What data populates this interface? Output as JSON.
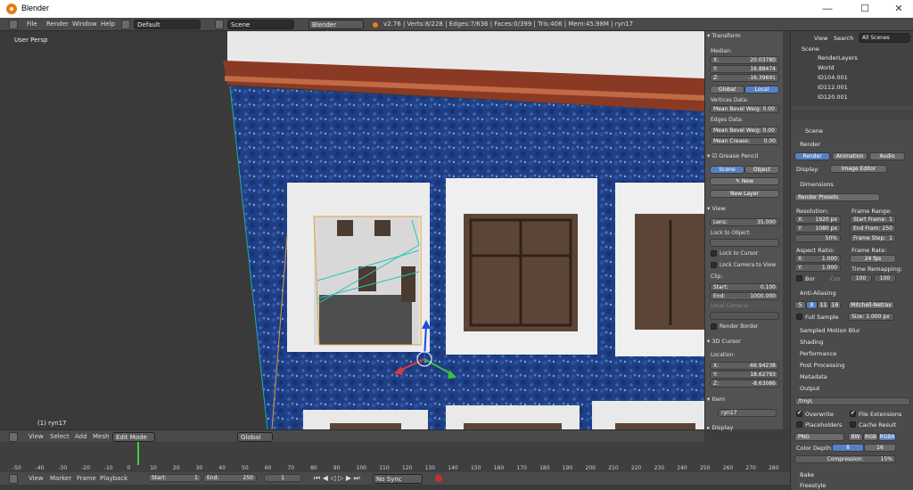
{
  "window": {
    "title": "Blender",
    "min": "—",
    "max": "☐",
    "close": "✕"
  },
  "topbar": {
    "menus": [
      "File",
      "Render",
      "Window",
      "Help"
    ],
    "layout": "Default",
    "scene": "Scene",
    "engine": "Blender Render",
    "stats": "v2.76 | Verts:8/228 | Edges:7/636 | Faces:0/399 | Tris:406 | Mem:45.98M | ryn17"
  },
  "viewport": {
    "view_label": "User Persp",
    "object_label": "(1) ryn17"
  },
  "npanel": {
    "transform": "Transform",
    "median": "Median:",
    "x": "X:",
    "x_val": "20.03780",
    "y": "Y:",
    "y_val": "16.88474",
    "z": "Z:",
    "z_val": "-16.39691",
    "global": "Global",
    "local": "Local",
    "vertices_data": "Vertices Data:",
    "mean_bevel_1": "Mean Bevel Weig: 0.00",
    "edges_data": "Edges Data:",
    "mean_bevel_2": "Mean Bevel Weig: 0.00",
    "mean_crease": "Mean Crease:",
    "mean_crease_val": "0.00",
    "grease": "Grease Pencil",
    "gp_scene": "Scene",
    "gp_object": "Object",
    "new": "New",
    "new_layer": "New Layer",
    "view": "View",
    "lens": "Lens:",
    "lens_val": "35.000",
    "lock_object": "Lock to Object:",
    "lock_cursor": "Lock to Cursor",
    "lock_camera": "Lock Camera to View",
    "clip": "Clip:",
    "start": "Start:",
    "start_val": "0.100",
    "end": "End:",
    "end_val": "1000.000",
    "local_camera": "Local Camera:",
    "render_border": "Render Border",
    "cursor3d": "3D Cursor",
    "location": "Location:",
    "cx": "X:",
    "cx_val": "-66.94238",
    "cy": "Y:",
    "cy_val": "18.62793",
    "cz": "Z:",
    "cz_val": "-8.63086",
    "item": "Item",
    "item_name": "ryn17",
    "display": "Display"
  },
  "outliner": {
    "view": "View",
    "search": "Search",
    "all_scenes": "All Scenes",
    "items": [
      "Scene",
      "RenderLayers",
      "World",
      "ID104.001",
      "ID112.001",
      "ID120.001"
    ]
  },
  "props": {
    "scene": "Scene",
    "render": "Render",
    "render_btn": "Render",
    "animation_btn": "Animation",
    "audio_btn": "Audio",
    "display": "Display:",
    "display_val": "Image Editor",
    "dimensions": "Dimensions",
    "presets": "Render Presets",
    "resolution": "Resolution:",
    "frame_range": "Frame Range:",
    "res_x": "X:",
    "res_x_val": "1920 px",
    "res_y": "Y:",
    "res_y_val": "1080 px",
    "res_pct": "50%",
    "start_frame": "Start Frame:",
    "start_frame_val": "1",
    "end_frame": "End Fram:",
    "end_frame_val": "250",
    "frame_step": "Frame Step:",
    "frame_step_val": "1",
    "aspect": "Aspect Ratio:",
    "frame_rate": "Frame Rate:",
    "asp_x": "X:",
    "asp_x_val": "1.000",
    "asp_y": "Y:",
    "asp_y_val": "1.000",
    "fps": "24 fps",
    "time_remap": "Time Remapping:",
    "remap_old": "100",
    "remap_new": "100",
    "bor": "Bor",
    "crop": "Cro",
    "anti_aliasing": "Anti-Aliasing",
    "aa_5": "5",
    "aa_8": "8",
    "aa_11": "11",
    "aa_16": "16",
    "filter": "Mitchell-Netrav",
    "full_sample": "Full Sample",
    "size": "Size: 1.000 px",
    "motion_blur": "Sampled Motion Blur",
    "shading": "Shading",
    "performance": "Performance",
    "post_processing": "Post Processing",
    "metadata": "Metadata",
    "output": "Output",
    "out_path": "/tmp\\",
    "overwrite": "Overwrite",
    "file_ext": "File Extensions",
    "placeholders": "Placeholders",
    "cache_result": "Cache Result",
    "format": "PNG",
    "bw": "BW",
    "rgb": "RGB",
    "rgba": "RGBA",
    "color_depth": "Color Depth:",
    "depth8": "8",
    "depth16": "16",
    "compression": "Compression:",
    "compression_val": "15%",
    "bake": "Bake",
    "freestyle": "Freestyle"
  },
  "viewheader": {
    "menus": [
      "View",
      "Select",
      "Add",
      "Mesh"
    ],
    "mode": "Edit Mode",
    "orientation": "Global"
  },
  "timeline": {
    "ticks": [
      "-50",
      "-40",
      "-30",
      "-20",
      "-10",
      "0",
      "10",
      "20",
      "30",
      "40",
      "50",
      "60",
      "70",
      "80",
      "90",
      "100",
      "110",
      "120",
      "130",
      "140",
      "150",
      "160",
      "170",
      "180",
      "190",
      "200",
      "210",
      "220",
      "230",
      "240",
      "250",
      "260",
      "270",
      "280"
    ],
    "end_tick": "280"
  },
  "tlheader": {
    "menus": [
      "View",
      "Marker",
      "Frame",
      "Playback"
    ],
    "start": "Start:",
    "start_val": "1",
    "end": "End:",
    "end_val": "250",
    "current": "1",
    "sync": "No Sync"
  }
}
